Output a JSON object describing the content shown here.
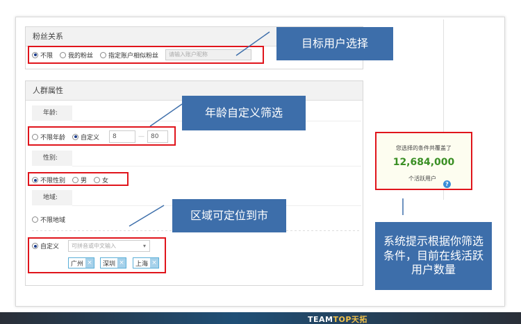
{
  "fans_section": {
    "title": "粉丝关系",
    "options": [
      "不限",
      "我的粉丝",
      "指定账户相似粉丝"
    ],
    "account_placeholder": "请输入账户昵称"
  },
  "crowd_section": {
    "title": "人群属性",
    "age": {
      "label": "年龄:",
      "options": [
        "不限年龄",
        "自定义"
      ],
      "min": "8",
      "separator": "—",
      "max": "80"
    },
    "gender": {
      "label": "性别:",
      "options": [
        "不限性别",
        "男",
        "女"
      ]
    },
    "region": {
      "label": "地域:",
      "unlimited": "不限地域",
      "custom": "自定义",
      "select_placeholder": "可拼音或中文输入",
      "tags": [
        "广州",
        "深圳",
        "上海"
      ]
    }
  },
  "summary": {
    "line1": "您选择的条件共覆盖了",
    "count": "12,684,000",
    "line3": "个活跃用户",
    "help": "?"
  },
  "callouts": {
    "target_user": "目标用户选择",
    "age_filter": "年龄自定义筛选",
    "region": "区域可定位到市",
    "system_tip": "系统提示根据你筛选条件，目前在线活跃用户数量"
  },
  "footer": {
    "brand_a": "TEAM",
    "brand_b": "TOP",
    "brand_c": "天拓"
  },
  "colors": {
    "callout_bg": "#3d6eaa",
    "highlight_border": "#e0141b",
    "count_green": "#3a8f24"
  }
}
